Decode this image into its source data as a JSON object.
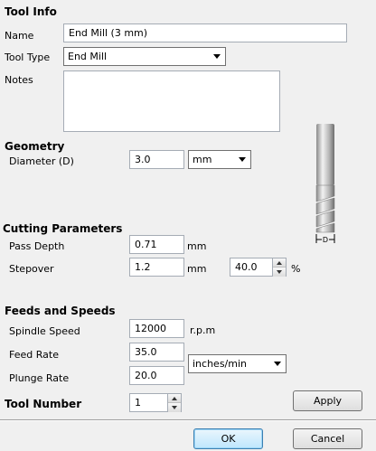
{
  "tool_info": {
    "title": "Tool Info",
    "name_label": "Name",
    "name_value": "End Mill (3 mm)",
    "tool_type_label": "Tool Type",
    "tool_type_value": "End Mill",
    "notes_label": "Notes",
    "notes_value": ""
  },
  "geometry": {
    "title": "Geometry",
    "diameter_label": "Diameter (D)",
    "diameter_value": "3.0",
    "unit_value": "mm",
    "illustration_label": "D"
  },
  "cutting": {
    "title": "Cutting Parameters",
    "pass_depth_label": "Pass Depth",
    "pass_depth_value": "0.71",
    "pass_depth_unit": "mm",
    "stepover_label": "Stepover",
    "stepover_value": "1.2",
    "stepover_unit": "mm",
    "stepover_percent_value": "40.0",
    "stepover_percent_unit": "%"
  },
  "feeds": {
    "title": "Feeds and Speeds",
    "spindle_label": "Spindle Speed",
    "spindle_value": "12000",
    "spindle_unit": "r.p.m",
    "feed_label": "Feed Rate",
    "feed_value": "35.0",
    "plunge_label": "Plunge Rate",
    "plunge_value": "20.0",
    "rate_unit_value": "inches/min"
  },
  "tool_number": {
    "label": "Tool Number",
    "value": "1"
  },
  "buttons": {
    "apply": "Apply",
    "ok": "OK",
    "cancel": "Cancel"
  }
}
